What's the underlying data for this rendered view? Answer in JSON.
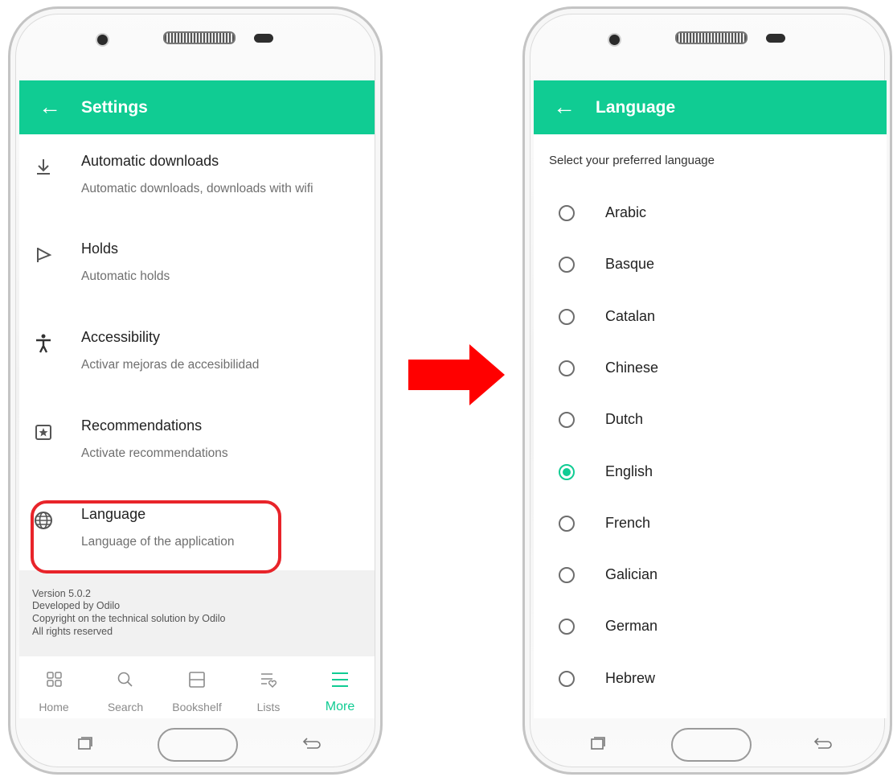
{
  "colors": {
    "accent": "#10cc93",
    "highlight": "#e8242a",
    "arrow": "#ff0000"
  },
  "settings_screen": {
    "title": "Settings",
    "back_icon": "arrow-left-icon",
    "items": [
      {
        "icon": "download-icon",
        "title": "Automatic downloads",
        "subtitle": "Automatic downloads, downloads with wifi"
      },
      {
        "icon": "flag-icon",
        "title": "Holds",
        "subtitle": "Automatic holds"
      },
      {
        "icon": "accessibility-icon",
        "title": "Accessibility",
        "subtitle": "Activar mejoras de accesibilidad"
      },
      {
        "icon": "star-badge-icon",
        "title": "Recommendations",
        "subtitle": "Activate recommendations"
      },
      {
        "icon": "globe-icon",
        "title": "Language",
        "subtitle": "Language of the application"
      }
    ],
    "footer": {
      "version": "Version 5.0.2",
      "developer": "Developed by Odilo",
      "copyright": "Copyright on the technical solution by Odilo",
      "rights": "All rights reserved"
    },
    "bottom_nav": [
      {
        "label": "Home",
        "icon": "grid-icon",
        "active": false
      },
      {
        "label": "Search",
        "icon": "search-icon",
        "active": false
      },
      {
        "label": "Bookshelf",
        "icon": "bookshelf-icon",
        "active": false
      },
      {
        "label": "Lists",
        "icon": "list-heart-icon",
        "active": false
      },
      {
        "label": "More",
        "icon": "menu-icon",
        "active": true
      }
    ]
  },
  "language_screen": {
    "title": "Language",
    "back_icon": "arrow-left-icon",
    "prompt": "Select your preferred language",
    "selected": "English",
    "languages": [
      "Arabic",
      "Basque",
      "Catalan",
      "Chinese",
      "Dutch",
      "English",
      "French",
      "Galician",
      "German",
      "Hebrew"
    ]
  }
}
